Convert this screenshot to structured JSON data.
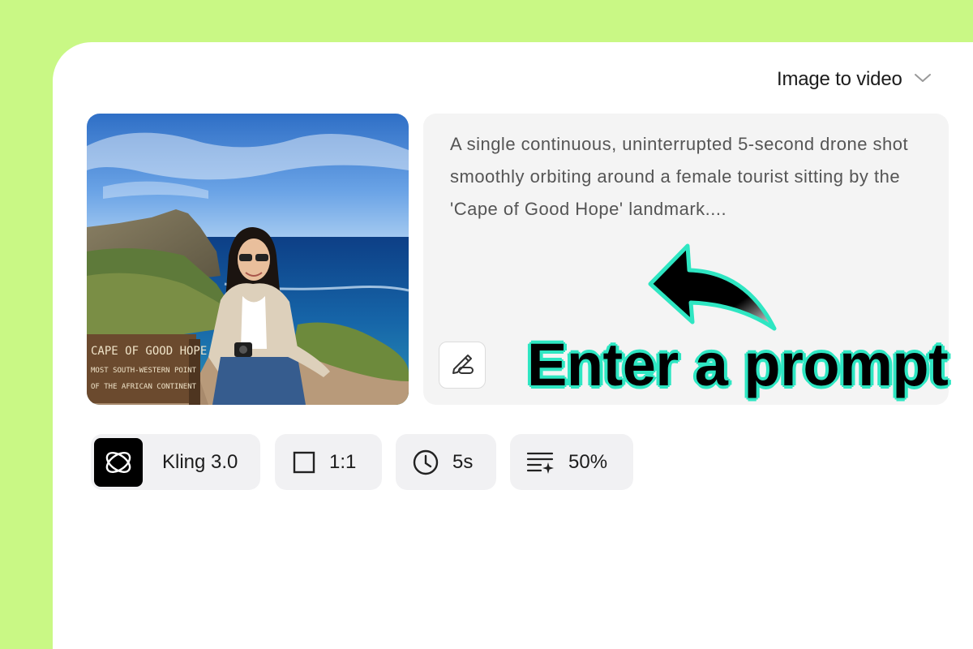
{
  "header": {
    "mode_label": "Image to video",
    "mode_icon": "chevron-down-icon"
  },
  "prompt": {
    "text": "A single continuous, uninterrupted 5-second drone shot smoothly orbiting around a female tourist sitting by the 'Cape of Good Hope' landmark....",
    "edit_icon": "pen-edit-icon"
  },
  "callout": {
    "text": "Enter a prompt",
    "outline_color": "#2ee6c2"
  },
  "image": {
    "sign_line1": "CAPE OF GOOD HOPE",
    "sign_line2": "MOST SOUTH-WESTERN POINT",
    "sign_line3": "OF THE AFRICAN CONTINENT"
  },
  "toolbar": {
    "model_label": "Kling 3.0",
    "ratio_label": "1:1",
    "duration_label": "5s",
    "strength_label": "50%"
  },
  "colors": {
    "background": "#c9f885",
    "panel": "#ffffff",
    "chip": "#f1f1f3",
    "prompt_box": "#f4f4f4"
  }
}
